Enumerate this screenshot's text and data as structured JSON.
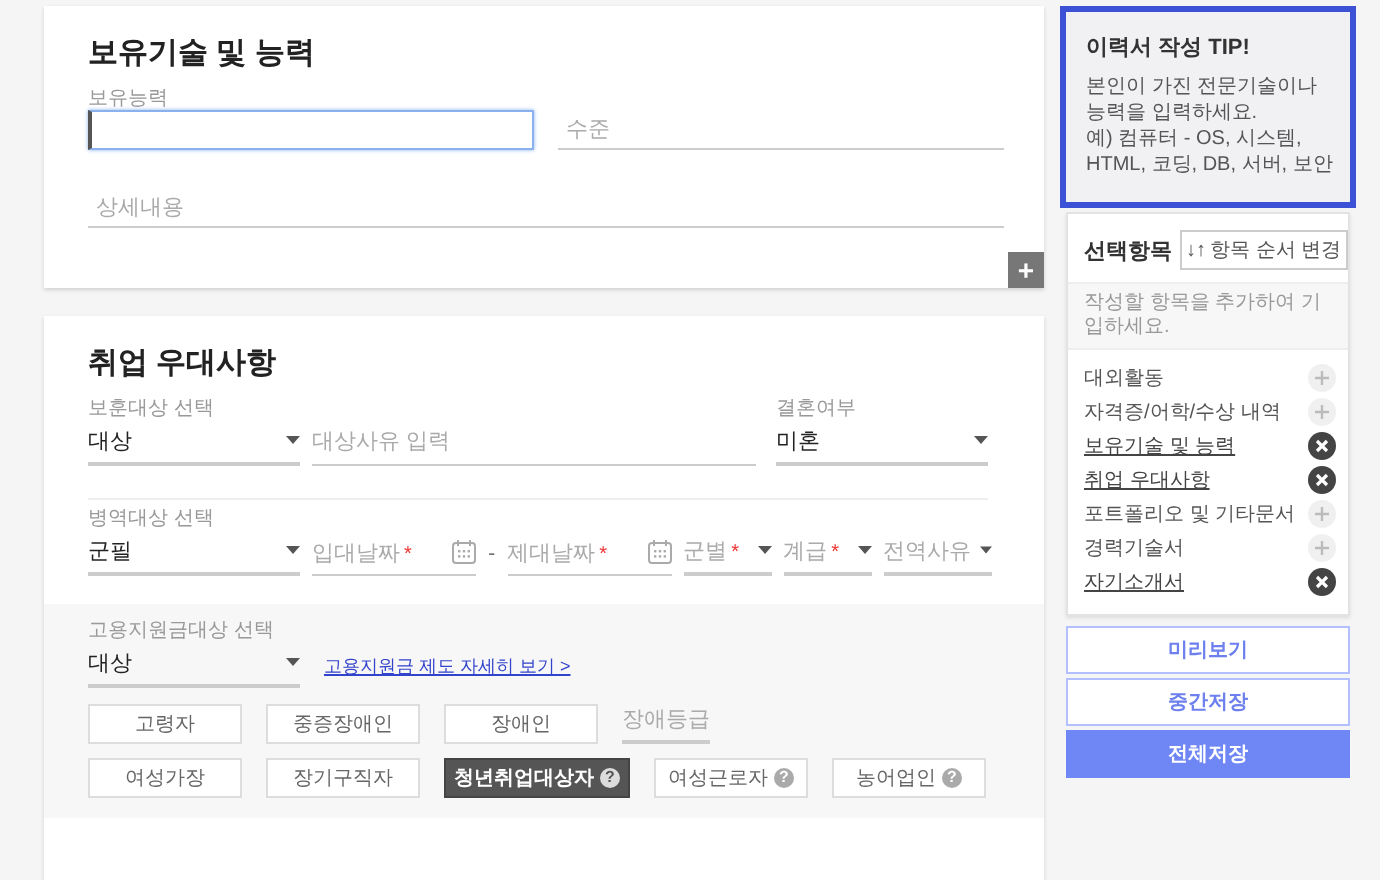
{
  "skills": {
    "title": "보유기술 및 능력",
    "lines": [
      {
        "fields": [
          {
            "kind": "input",
            "label": "보유능력",
            "focused": true
          },
          {
            "kind": "input",
            "placeholder": "수준",
            "focused": false
          }
        ]
      },
      {
        "fields": [
          {
            "kind": "input",
            "placeholder": "상세내용",
            "focused": false
          }
        ]
      }
    ],
    "add_button": "+"
  },
  "preferences": {
    "title": "취업 우대사항",
    "lines": [
      {
        "fields": [
          {
            "kind": "select",
            "label": "보훈대상 선택",
            "value": "대상"
          },
          {
            "kind": "input",
            "placeholder": "대상사유 입력"
          },
          {
            "kind": "select",
            "label": "결혼여부",
            "value": "미혼"
          }
        ]
      },
      {
        "fields": [
          {
            "kind": "select",
            "label": "병역대상 선택",
            "value": "군필"
          },
          {
            "kind": "date",
            "placeholder": "입대날짜",
            "required_mark": "*"
          },
          {
            "kind": "separator",
            "text": "-"
          },
          {
            "kind": "date",
            "placeholder": "제대날짜",
            "required_mark": "*"
          },
          {
            "kind": "select",
            "placeholder": "군별",
            "required_mark": "*"
          },
          {
            "kind": "select",
            "placeholder": "계급",
            "required_mark": "*"
          },
          {
            "kind": "select",
            "placeholder": "전역사유"
          }
        ]
      }
    ],
    "subsidy": {
      "select": {
        "label": "고용지원금대상 선택",
        "value": "대상"
      },
      "link": "고용지원금 제도 자세히 보기 >",
      "option_groups": [
        {
          "items": [
            {
              "kind": "option",
              "label": "고령자",
              "selected": false
            },
            {
              "kind": "option",
              "label": "중증장애인",
              "selected": false
            },
            {
              "kind": "option",
              "label": "장애인",
              "selected": false
            },
            {
              "kind": "select",
              "placeholder": "장애등급"
            }
          ]
        },
        {
          "items": [
            {
              "kind": "option",
              "label": "여성가장",
              "selected": false
            },
            {
              "kind": "option",
              "label": "장기구직자",
              "selected": false
            },
            {
              "kind": "option",
              "label": "청년취업대상자",
              "selected": true,
              "help": "?"
            },
            {
              "kind": "option",
              "label": "여성근로자",
              "selected": false,
              "help": "?"
            },
            {
              "kind": "option",
              "label": "농어업인",
              "selected": false,
              "help": "?"
            }
          ]
        }
      ]
    }
  },
  "sidebar": {
    "tip": {
      "title": "이력서 작성 TIP!",
      "lines": [
        "본인이 가진 전문기술이나 능력을 입력하세요.",
        "예) 컴퓨터 - OS, 시스템, HTML, 코딩, DB, 서버, 보안"
      ]
    },
    "selection": {
      "title": "선택항목",
      "sort_button": {
        "icon": "↓↑",
        "label": "항목 순서 변경"
      },
      "hint": "작성할 항목을 추가하여 기입하세요.",
      "items": [
        {
          "label": "대외활동",
          "added": false
        },
        {
          "label": "자격증/어학/수상 내역",
          "added": false
        },
        {
          "label": "보유기술 및 능력",
          "added": true
        },
        {
          "label": "취업 우대사항",
          "added": true
        },
        {
          "label": "포트폴리오 및 기타문서",
          "added": false
        },
        {
          "label": "경력기술서",
          "added": false
        },
        {
          "label": "자기소개서",
          "added": true
        }
      ]
    },
    "buttons": [
      {
        "label": "미리보기",
        "kind": "outline"
      },
      {
        "label": "중간저장",
        "kind": "outline"
      },
      {
        "label": "전체저장",
        "kind": "primary"
      }
    ]
  }
}
